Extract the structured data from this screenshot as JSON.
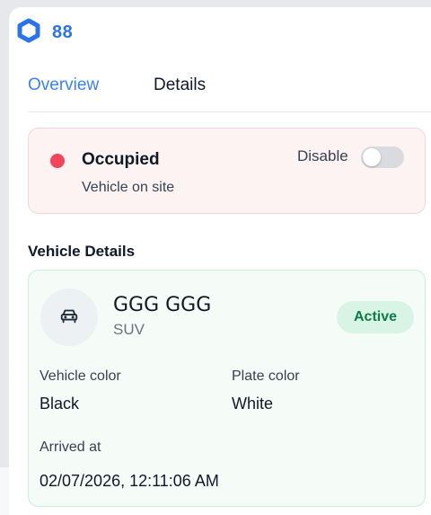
{
  "header": {
    "id": "88"
  },
  "tabs": [
    {
      "label": "Overview",
      "active": true
    },
    {
      "label": "Details",
      "active": false
    }
  ],
  "status": {
    "title": "Occupied",
    "subtitle": "Vehicle on site",
    "toggle_label": "Disable",
    "toggle_on": false,
    "dot_color": "#f2455b"
  },
  "vehicle_section": {
    "title": "Vehicle Details",
    "plate": "GGG GGG",
    "type": "SUV",
    "badge": "Active",
    "icon": "car-icon",
    "color_label": "Vehicle color",
    "color_value": "Black",
    "plate_color_label": "Plate color",
    "plate_color_value": "White",
    "arrived_label": "Arrived at",
    "arrived_value": "02/07/2026, 12:11:06 AM"
  },
  "colors": {
    "accent": "#3b82f6",
    "status_bg": "#fdf3f3",
    "active_badge_bg": "#d8f4e4",
    "active_badge_text": "#0f7a47"
  }
}
